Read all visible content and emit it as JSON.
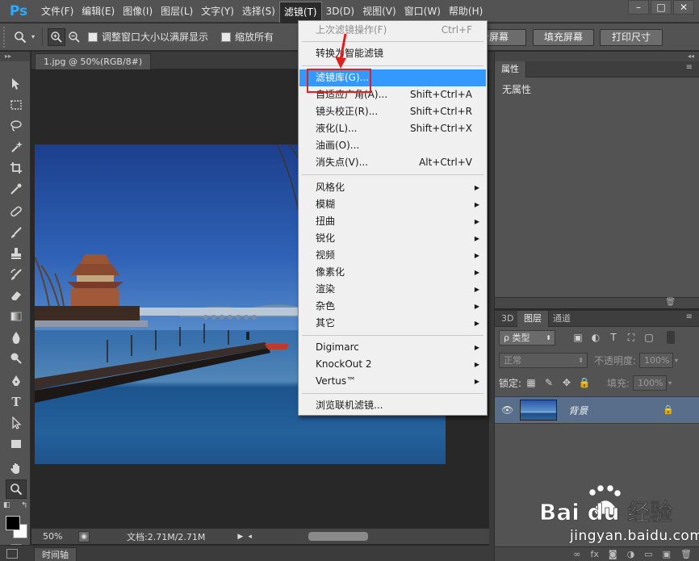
{
  "app": {
    "logo": "Ps"
  },
  "menubar": {
    "items": [
      "文件(F)",
      "编辑(E)",
      "图像(I)",
      "图层(L)",
      "文字(Y)",
      "选择(S)",
      "滤镜(T)",
      "3D(D)",
      "视图(V)",
      "窗口(W)",
      "帮助(H)"
    ],
    "active": "滤镜(T)"
  },
  "window_controls": {
    "minimize": "–",
    "maximize": "□",
    "close": "✕"
  },
  "options_bar": {
    "check_resize": "调整窗口大小以满屏显示",
    "check_zoom_all": "缩放所有",
    "btn_fit": "适合屏幕",
    "btn_fill": "填充屏幕",
    "btn_print": "打印尺寸"
  },
  "document": {
    "tab_title": "1.jpg @ 50%(RGB/8#)",
    "zoom": "50%",
    "doc_info": "文档:2.71M/2.71M"
  },
  "timeline": {
    "tab": "时间轴"
  },
  "properties_panel": {
    "tab": "属性",
    "body_text": "无属性"
  },
  "layers_panel": {
    "tabs": [
      "3D",
      "图层",
      "通道"
    ],
    "filter_kind": "ρ 类型",
    "blend_mode": "正常",
    "opacity_label": "不透明度:",
    "opacity_value": "100%",
    "lock_label": "锁定:",
    "fill_label": "填充:",
    "fill_value": "100%",
    "layer_name": "背景"
  },
  "filter_menu": {
    "last_filter": {
      "label": "上次滤镜操作(F)",
      "shortcut": "Ctrl+F"
    },
    "convert_smart": "转换为智能滤镜",
    "filter_gallery": "滤镜库(G)...",
    "adaptive_wide": {
      "label": "自适应广角(A)...",
      "shortcut": "Shift+Ctrl+A"
    },
    "lens_correction": {
      "label": "镜头校正(R)...",
      "shortcut": "Shift+Ctrl+R"
    },
    "liquify": {
      "label": "液化(L)...",
      "shortcut": "Shift+Ctrl+X"
    },
    "oil_paint": "油画(O)...",
    "vanishing_point": {
      "label": "消失点(V)...",
      "shortcut": "Alt+Ctrl+V"
    },
    "submenus": [
      "风格化",
      "模糊",
      "扭曲",
      "锐化",
      "视频",
      "像素化",
      "渲染",
      "杂色",
      "其它"
    ],
    "plugins": [
      "Digimarc",
      "KnockOut 2",
      "Vertus™"
    ],
    "browse_online": "浏览联机滤镜..."
  },
  "watermark": {
    "brand": "Bai du 经验",
    "url": "jingyan.baidu.com"
  },
  "colors": {
    "menu_highlight": "#3399ff",
    "annotation_red": "#e02020",
    "ps_blue": "#31a8ff"
  }
}
